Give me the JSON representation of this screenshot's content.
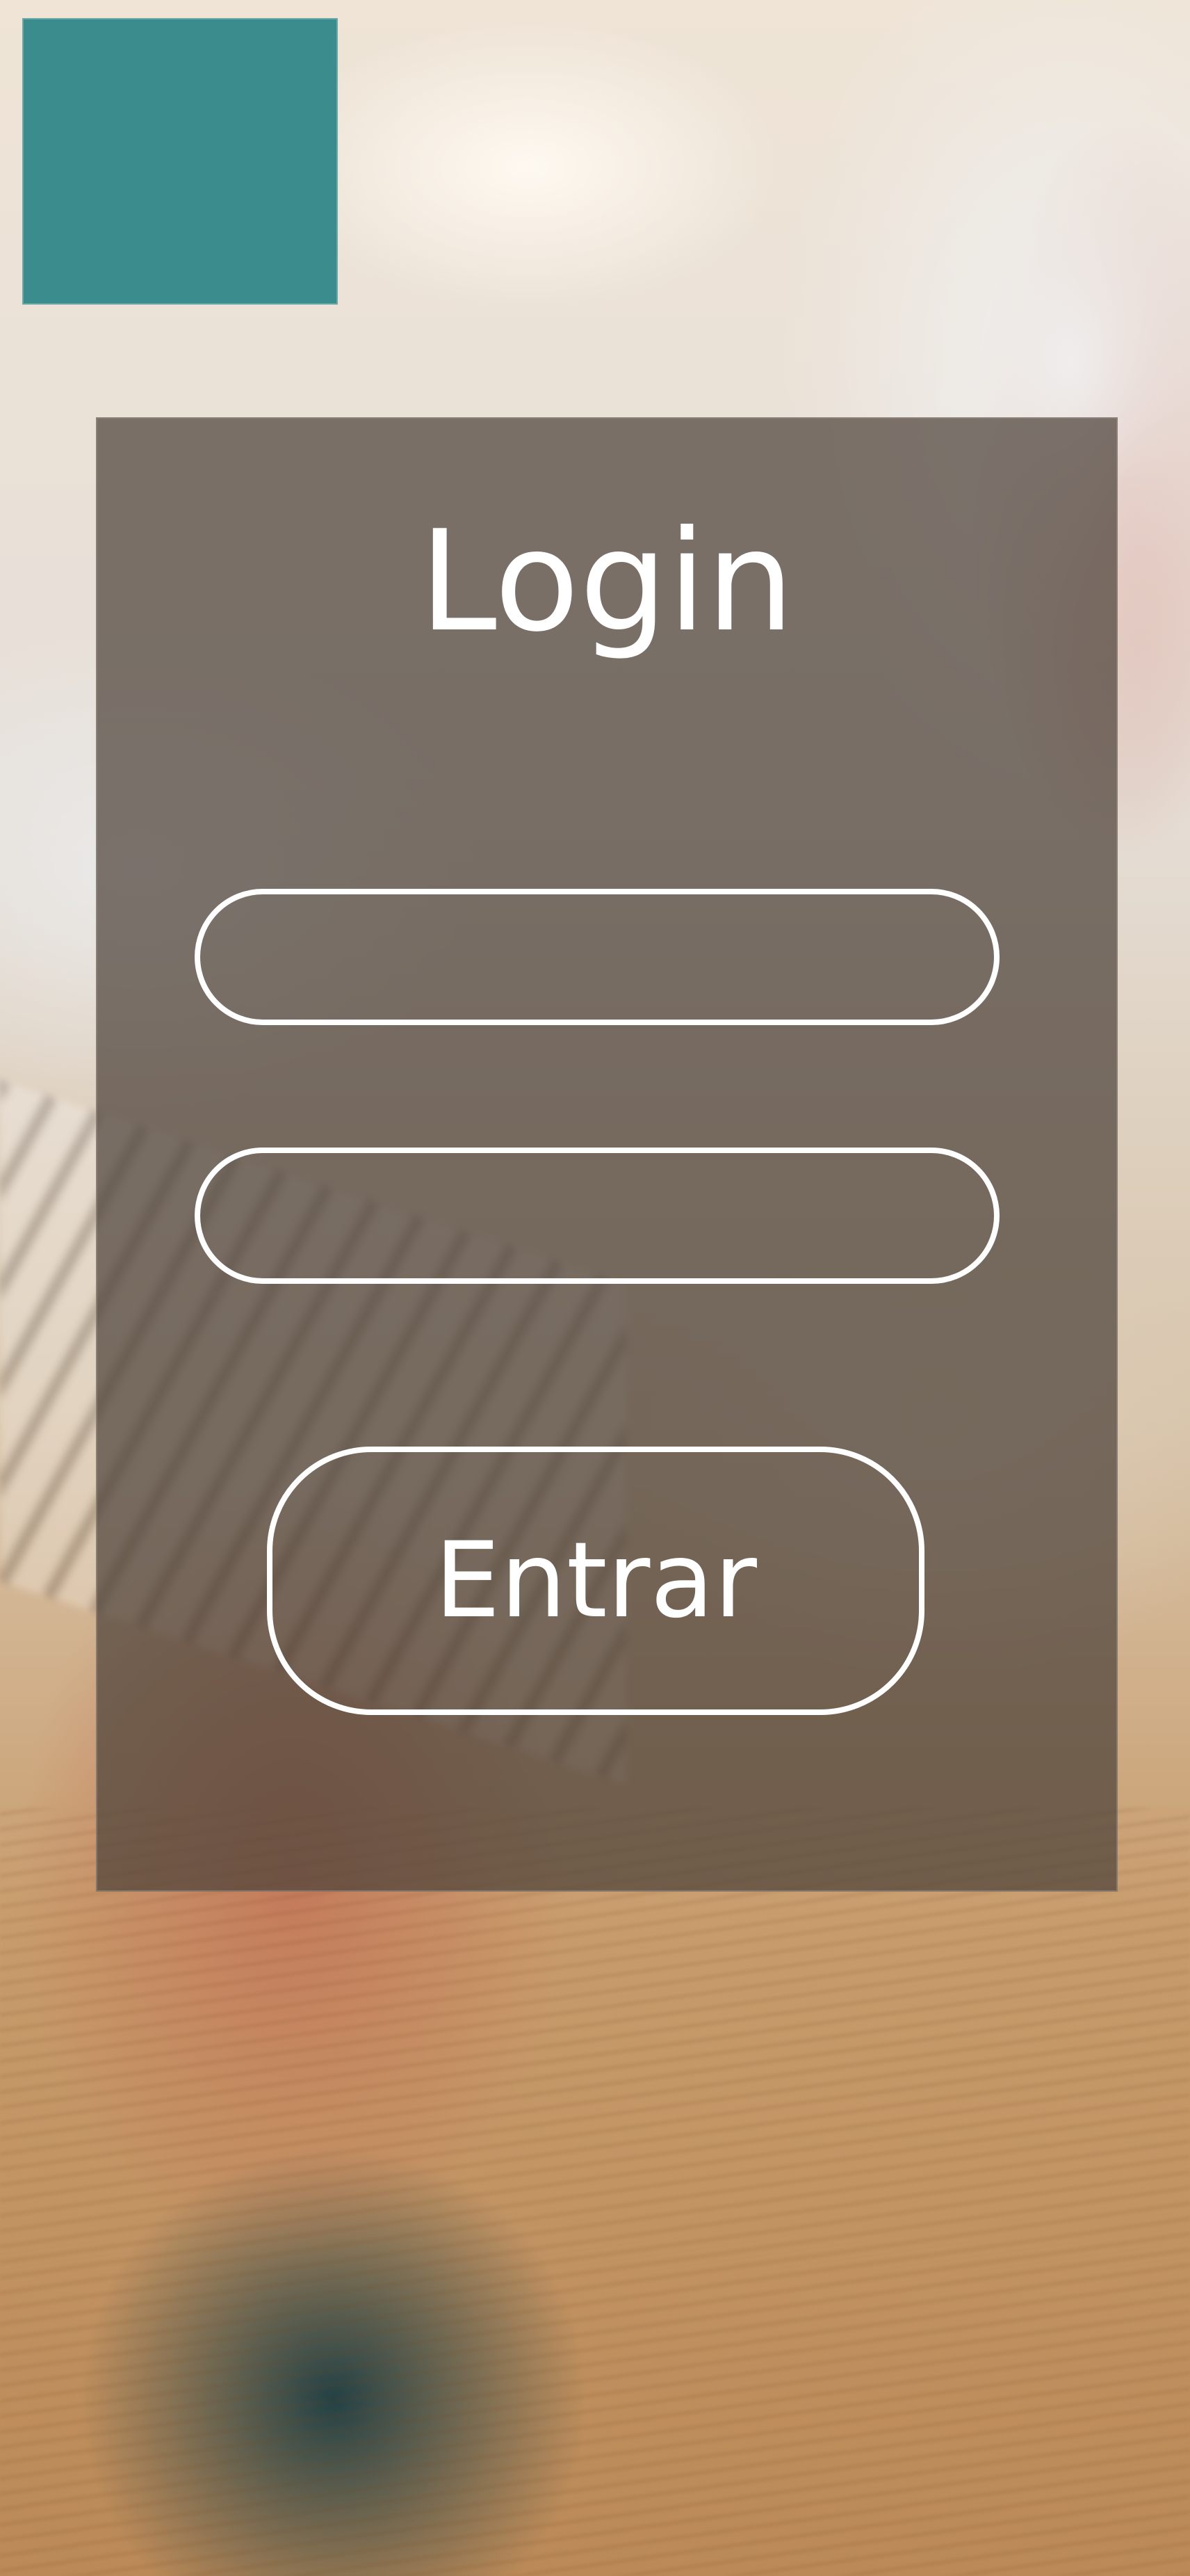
{
  "login": {
    "title": "Login",
    "username_placeholder": "",
    "password_placeholder": "",
    "submit_label": "Entrar"
  },
  "colors": {
    "logo_block": "#3a8d8c",
    "panel_overlay": "#4e423a",
    "text": "#ffffff"
  }
}
